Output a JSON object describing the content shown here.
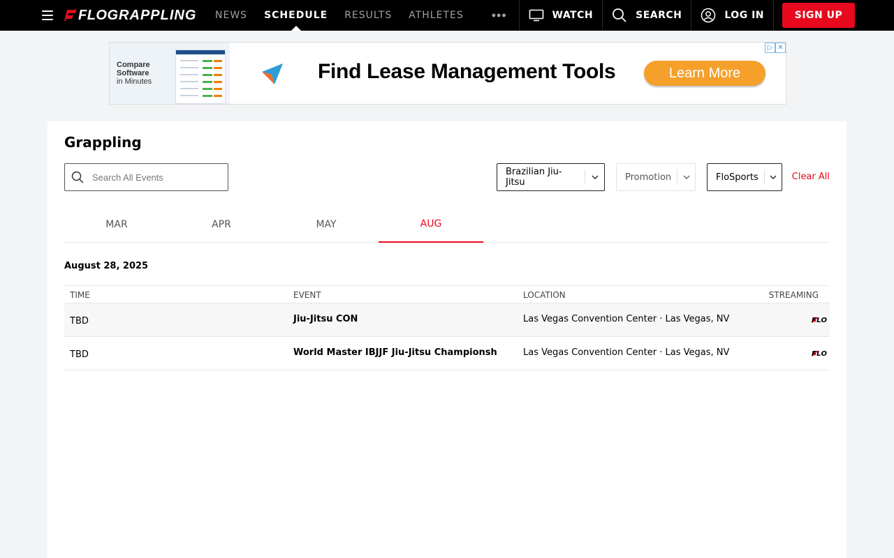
{
  "nav": {
    "brand_flo": "FLO",
    "brand_sport": "GRAPPLING",
    "links": [
      {
        "label": "NEWS"
      },
      {
        "label": "SCHEDULE"
      },
      {
        "label": "RESULTS"
      },
      {
        "label": "ATHLETES"
      }
    ],
    "more": "•••",
    "watch": "WATCH",
    "search": "SEARCH",
    "login": "LOG IN",
    "signup": "SIGN UP"
  },
  "ad": {
    "left_title": "Compare Software",
    "left_sub": "in Minutes",
    "headline": "Find Lease Management Tools",
    "cta": "Learn More",
    "badge_info": "▷",
    "badge_close": "✕"
  },
  "page": {
    "title": "Grappling",
    "search_placeholder": "Search All Events",
    "filters": {
      "discipline": "Brazilian Jiu-Jitsu",
      "promotion": "Promotion",
      "provider": "FloSports"
    },
    "clear_all": "Clear All"
  },
  "months": [
    {
      "label": "MAR"
    },
    {
      "label": "APR"
    },
    {
      "label": "MAY"
    },
    {
      "label": "AUG"
    }
  ],
  "schedule": {
    "date": "August 28, 2025",
    "headers": {
      "time": "TIME",
      "event": "EVENT",
      "location": "LOCATION",
      "streaming": "STREAMING"
    },
    "rows": [
      {
        "time": "TBD",
        "event": "Jiu-Jitsu CON",
        "location": "Las Vegas Convention Center · Las Vegas, NV",
        "streaming": "FLO"
      },
      {
        "time": "TBD",
        "event": "World Master IBJJF Jiu-Jitsu Championsh",
        "location": "Las Vegas Convention Center · Las Vegas, NV",
        "streaming": "FLO"
      }
    ]
  },
  "colors": {
    "brand_red": "#e8091e",
    "nav_bg": "#000000",
    "page_bg": "#f3f4f6",
    "ad_cta": "#f5a02b"
  }
}
